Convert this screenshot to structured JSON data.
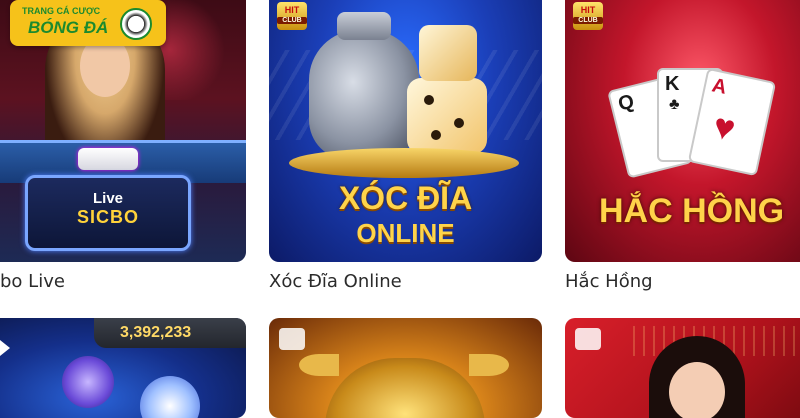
{
  "logo": {
    "line1": "TRANG CÁ CƯỢC",
    "line2": "BÓNG ĐÁ"
  },
  "games_row1": [
    {
      "label": "bo Live",
      "art_line1": "Live",
      "art_line2": "SICBO"
    },
    {
      "label": "Xóc Đĩa Online",
      "art_line1": "XÓC ĐĨA",
      "art_line2": "ONLINE",
      "badge": "HIT",
      "badge_sub": "CLUB"
    },
    {
      "label": "Hắc Hồng",
      "art_line1": "HẮC HỒNG",
      "badge": "HIT",
      "badge_sub": "CLUB",
      "card1": "Q",
      "card2": "K",
      "card3": "A"
    }
  ],
  "games_row2": [
    {
      "jackpot": "3,392,233"
    },
    {},
    {}
  ],
  "colors": {
    "label_text": "#2b2b2b",
    "logo_bg": "#f6c21a",
    "logo_text": "#1c8a2e"
  }
}
